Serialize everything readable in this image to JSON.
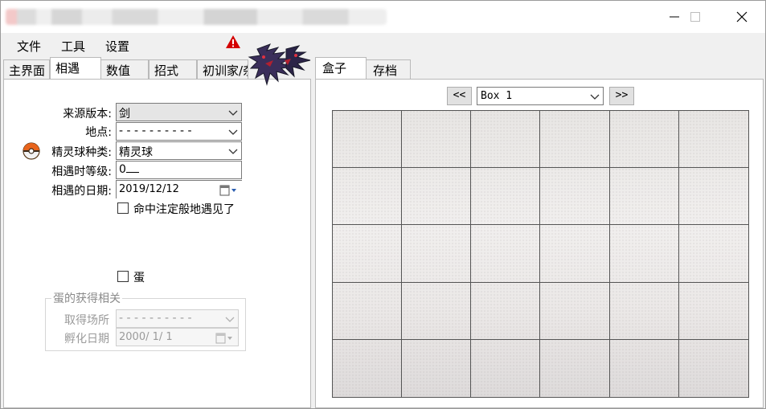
{
  "window": {
    "minimize_icon": "minimize-icon",
    "maximize_icon": "maximize-icon",
    "close_icon": "close-icon"
  },
  "menu": {
    "file": "文件",
    "tools": "工具",
    "settings": "设置",
    "warning_icon": "warning-icon",
    "warning_color": "#d40000"
  },
  "left_tabs": [
    "主界面",
    "相遇",
    "数值",
    "招式",
    "初训家/杂项"
  ],
  "active_left_tab": "相遇",
  "encounter": {
    "origin_game_label": "来源版本:",
    "origin_game_value": "剑",
    "location_label": "地点:",
    "location_value": "- - - - - - - - - -",
    "ball_label": "精灵球种类:",
    "ball_value": "精灵球",
    "ball_icon": "pokeball-icon",
    "level_label": "相遇时等级:",
    "level_value": "0",
    "date_label": "相遇的日期:",
    "date_value": "2019/12/12",
    "fateful_label": "命中注定般地遇见了",
    "fateful_checked": false,
    "egg_label": "蛋",
    "egg_checked": false
  },
  "egg_group": {
    "title": "蛋的获得相关",
    "location_label": "取得场所",
    "location_value": "- - - - - - - - - -",
    "hatch_date_label": "孵化日期",
    "hatch_date_value": "2000/ 1/ 1"
  },
  "right_tabs": [
    "盒子",
    "存档"
  ],
  "active_right_tab": "盒子",
  "box": {
    "prev_label": "<<",
    "next_label": ">>",
    "selected_box": "Box 1",
    "rows": 5,
    "cols": 6
  }
}
